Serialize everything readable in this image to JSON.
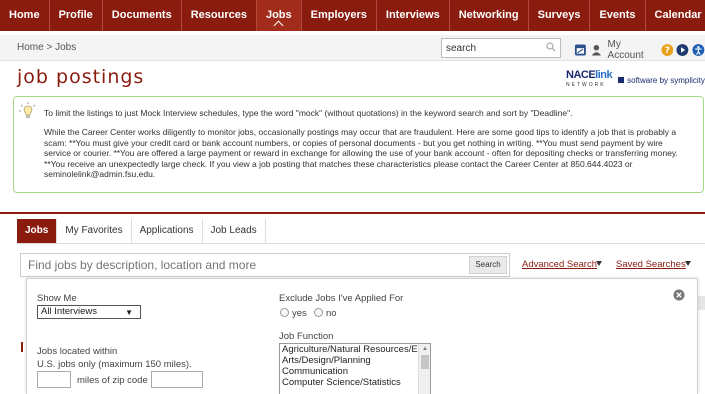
{
  "nav": {
    "items": [
      "Home",
      "Profile",
      "Documents",
      "Resources",
      "Jobs",
      "Employers",
      "Interviews",
      "Networking",
      "Surveys",
      "Events",
      "Calendar"
    ],
    "active": "Jobs"
  },
  "breadcrumb": "Home > Jobs",
  "site_search": {
    "value": "search"
  },
  "account": {
    "label": "My Account"
  },
  "page_title": "job postings",
  "brand": {
    "nace": "NACE",
    "nace_suffix": "link",
    "nace_sub": "NETWORK",
    "simplicity": "software by symplicity"
  },
  "notice": {
    "tip": "To limit the listings to just Mock Interview schedules, type the word \"mock\" (without quotations) in the keyword search and sort by \"Deadline\".",
    "body": "While the Career Center works diligently to monitor jobs, occasionally postings may occur that are fraudulent. Here are some good tips to identify a job that is probably a scam: **You must give your credit card or bank account numbers, or copies of personal documents - but you get nothing in writing. **You must send payment by wire service or courier. **You are offered a large payment or reward in exchange for allowing the use of your bank account - often for depositing checks or transferring money. **You receive an unexpectedly large check. If you view a job posting that matches these characteristics please contact the Career Center at 850.644.4023 or seminolelink@admin.fsu.edu."
  },
  "tabs": [
    "Jobs",
    "My Favorites",
    "Applications",
    "Job Leads"
  ],
  "job_search": {
    "placeholder": "Find jobs by description, location and more",
    "button": "Search",
    "advanced": "Advanced Search",
    "saved": "Saved Searches"
  },
  "filters": {
    "show_me_label": "Show Me",
    "show_me_value": "All Interviews",
    "exclude_label": "Exclude Jobs I've Applied For",
    "yes": "yes",
    "no": "no",
    "located_label": "Jobs located within",
    "us_jobs": "U.S. jobs only (maximum 150 miles).",
    "miles_of_zip": "miles of zip code",
    "job_function_label": "Job Function",
    "job_functions": [
      "Agriculture/Natural Resources/En",
      "Arts/Design/Planning",
      "Communication",
      "Computer Science/Statistics"
    ]
  },
  "colors": {
    "brand": "#8a1c0f",
    "notice_border": "#a6d98a",
    "link": "#8a1c0f"
  }
}
